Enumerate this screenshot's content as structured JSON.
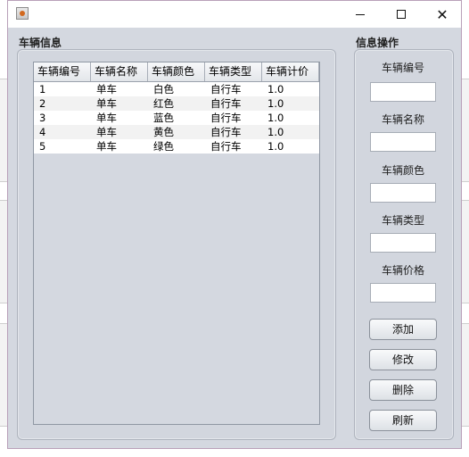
{
  "window": {
    "title": "",
    "controls": {
      "minimize": "minimize",
      "maximize": "maximize",
      "close": "✕"
    }
  },
  "backdrop_glyphs": [
    "",
    "",
    ""
  ],
  "vehicle_info": {
    "title": "车辆信息",
    "columns": [
      "车辆编号",
      "车辆名称",
      "车辆颜色",
      "车辆类型",
      "车辆计价"
    ],
    "rows": [
      [
        "1",
        "单车",
        "白色",
        "自行车",
        "1.0"
      ],
      [
        "2",
        "单车",
        "红色",
        "自行车",
        "1.0"
      ],
      [
        "3",
        "单车",
        "蓝色",
        "自行车",
        "1.0"
      ],
      [
        "4",
        "单车",
        "黄色",
        "自行车",
        "1.0"
      ],
      [
        "5",
        "单车",
        "绿色",
        "自行车",
        "1.0"
      ]
    ]
  },
  "operations": {
    "title": "信息操作",
    "fields": [
      {
        "label": "车辆编号",
        "value": ""
      },
      {
        "label": "车辆名称",
        "value": ""
      },
      {
        "label": "车辆颜色",
        "value": ""
      },
      {
        "label": "车辆类型",
        "value": ""
      },
      {
        "label": "车辆价格",
        "value": ""
      }
    ],
    "buttons": {
      "add": "添加",
      "edit": "修改",
      "delete": "删除",
      "refresh": "刷新"
    }
  }
}
